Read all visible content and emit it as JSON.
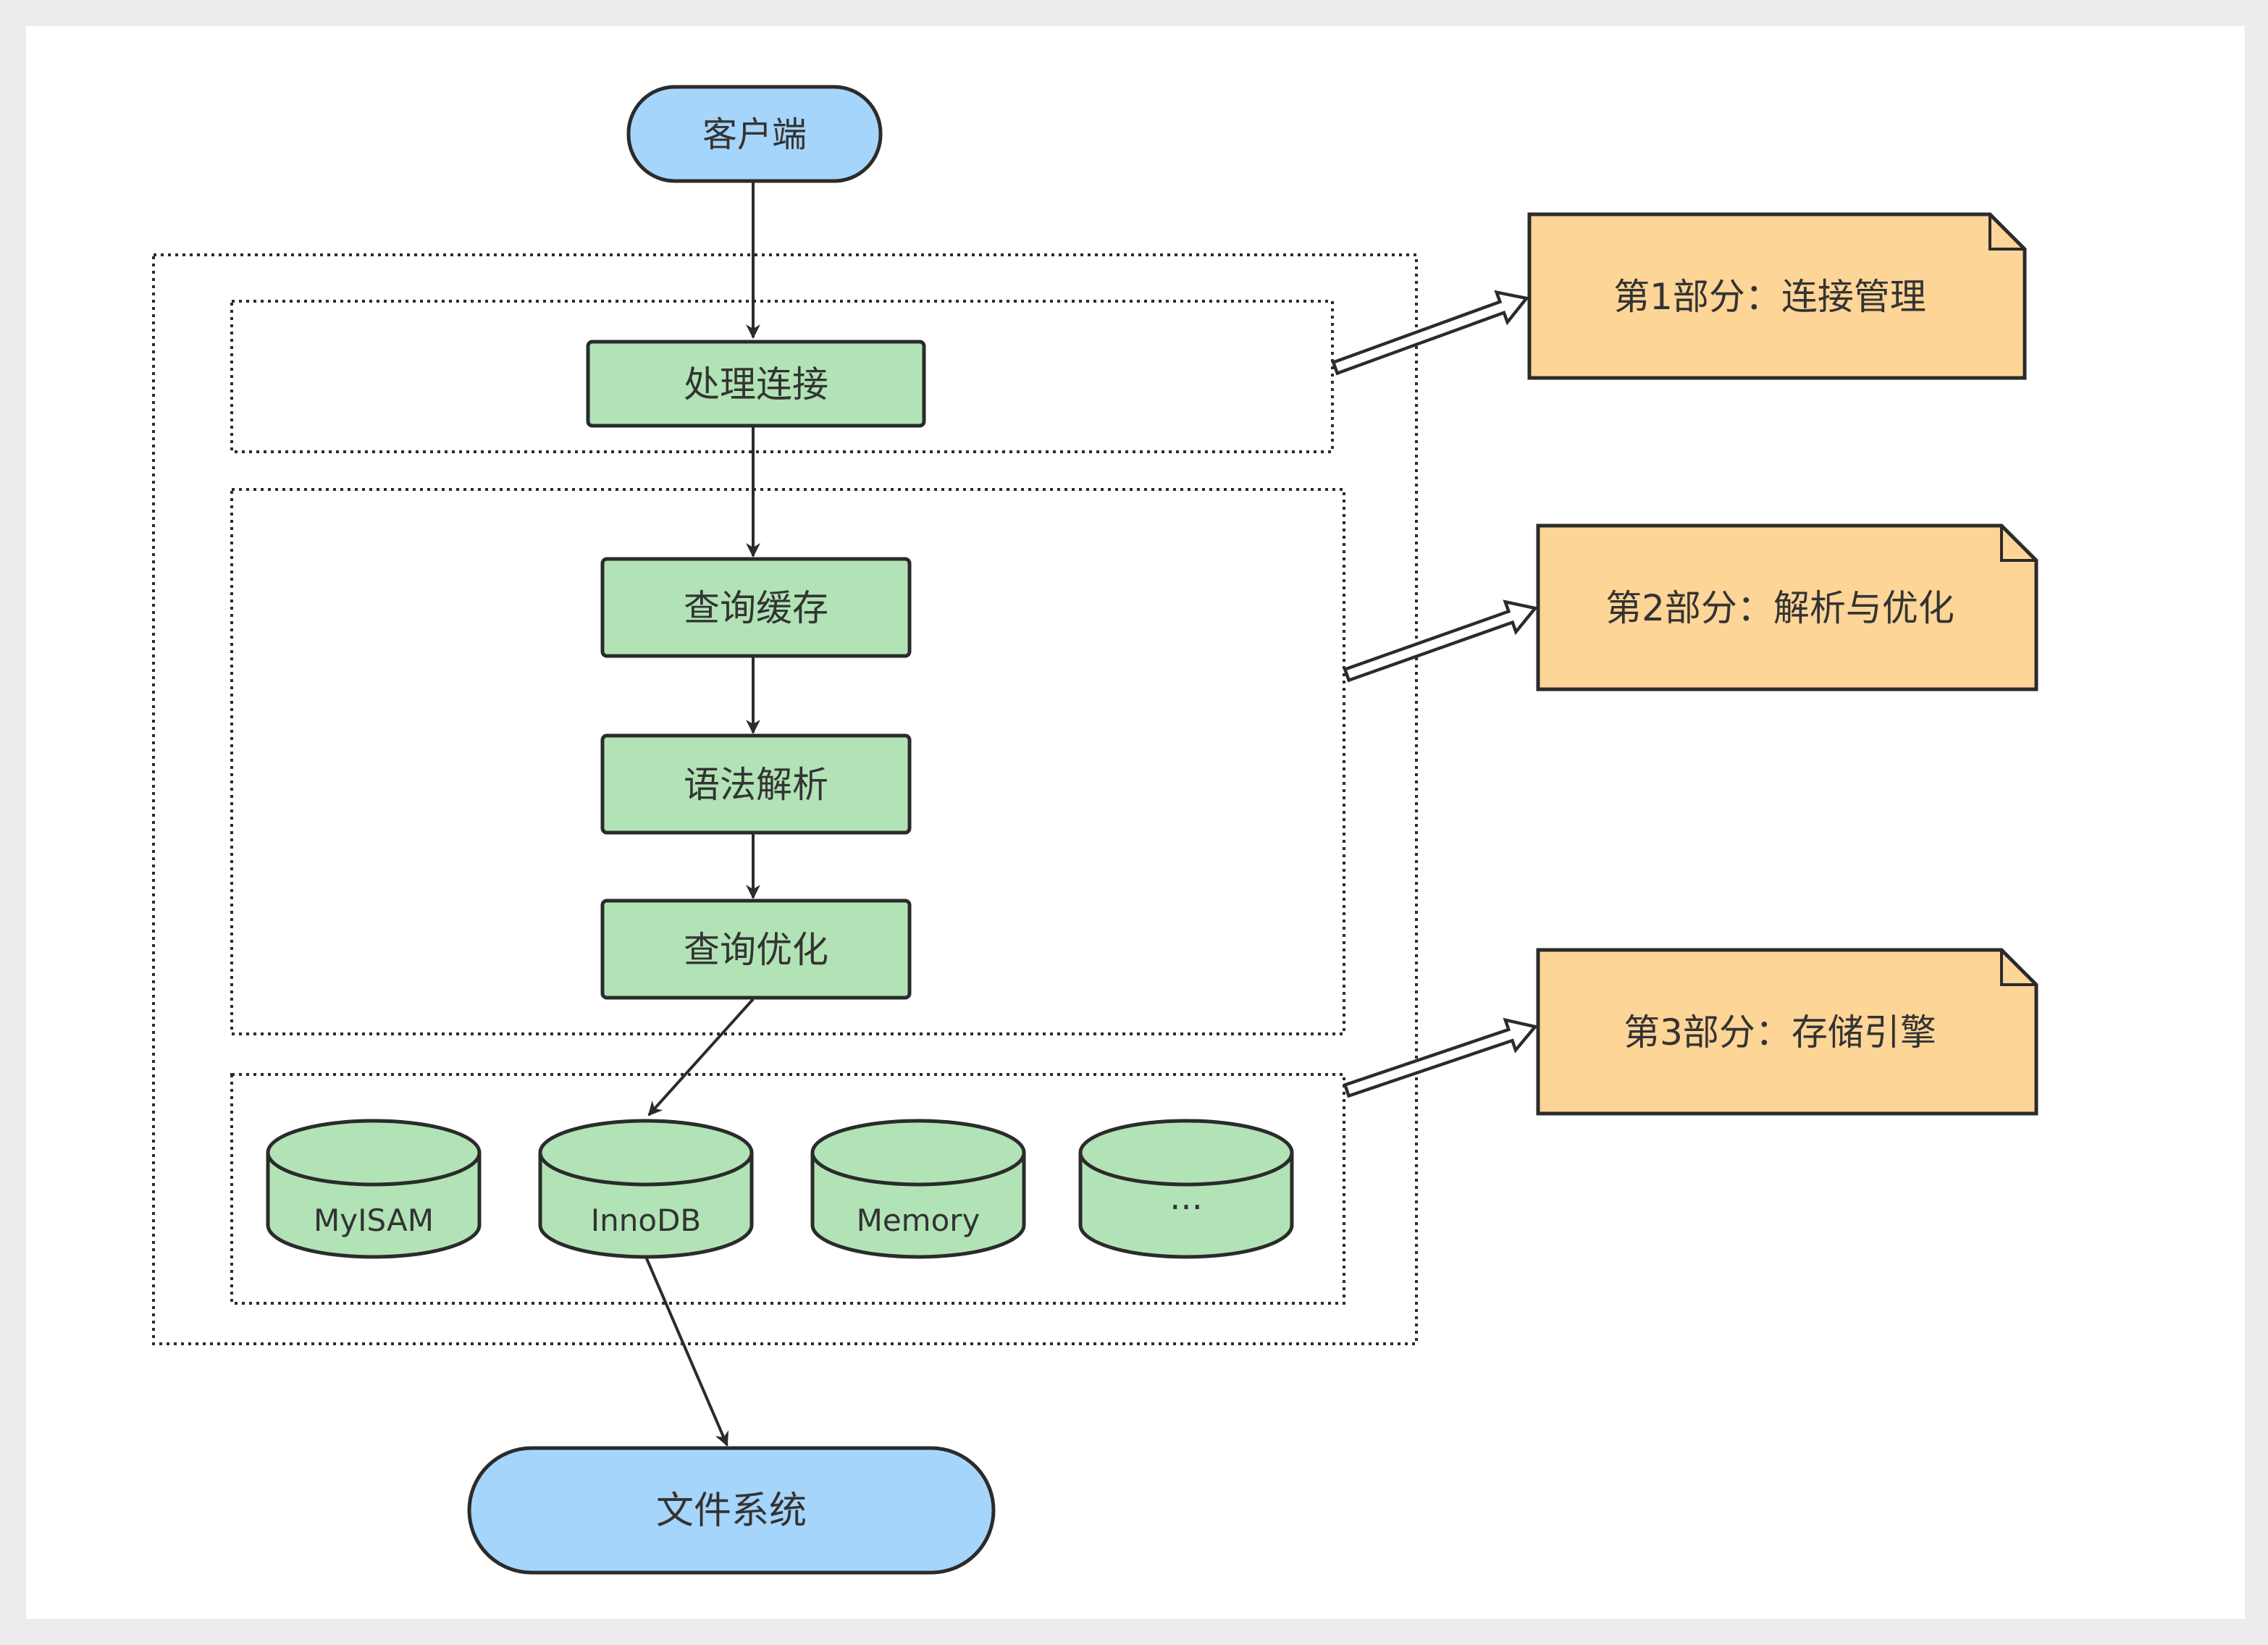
{
  "colors": {
    "terminal": "#a6d5fb",
    "process": "#b2e3b6",
    "note": "#fdd597",
    "stroke": "#2b2b2b"
  },
  "nodes": {
    "client": "客户端",
    "connection": "处理连接",
    "query_cache": "查询缓存",
    "parser": "语法解析",
    "optimizer": "查询优化",
    "filesystem": "文件系统"
  },
  "engines": [
    "MyISAM",
    "InnoDB",
    "Memory",
    "···"
  ],
  "notes": [
    "第1部分：连接管理",
    "第2部分：解析与优化",
    "第3部分：存储引擎"
  ]
}
